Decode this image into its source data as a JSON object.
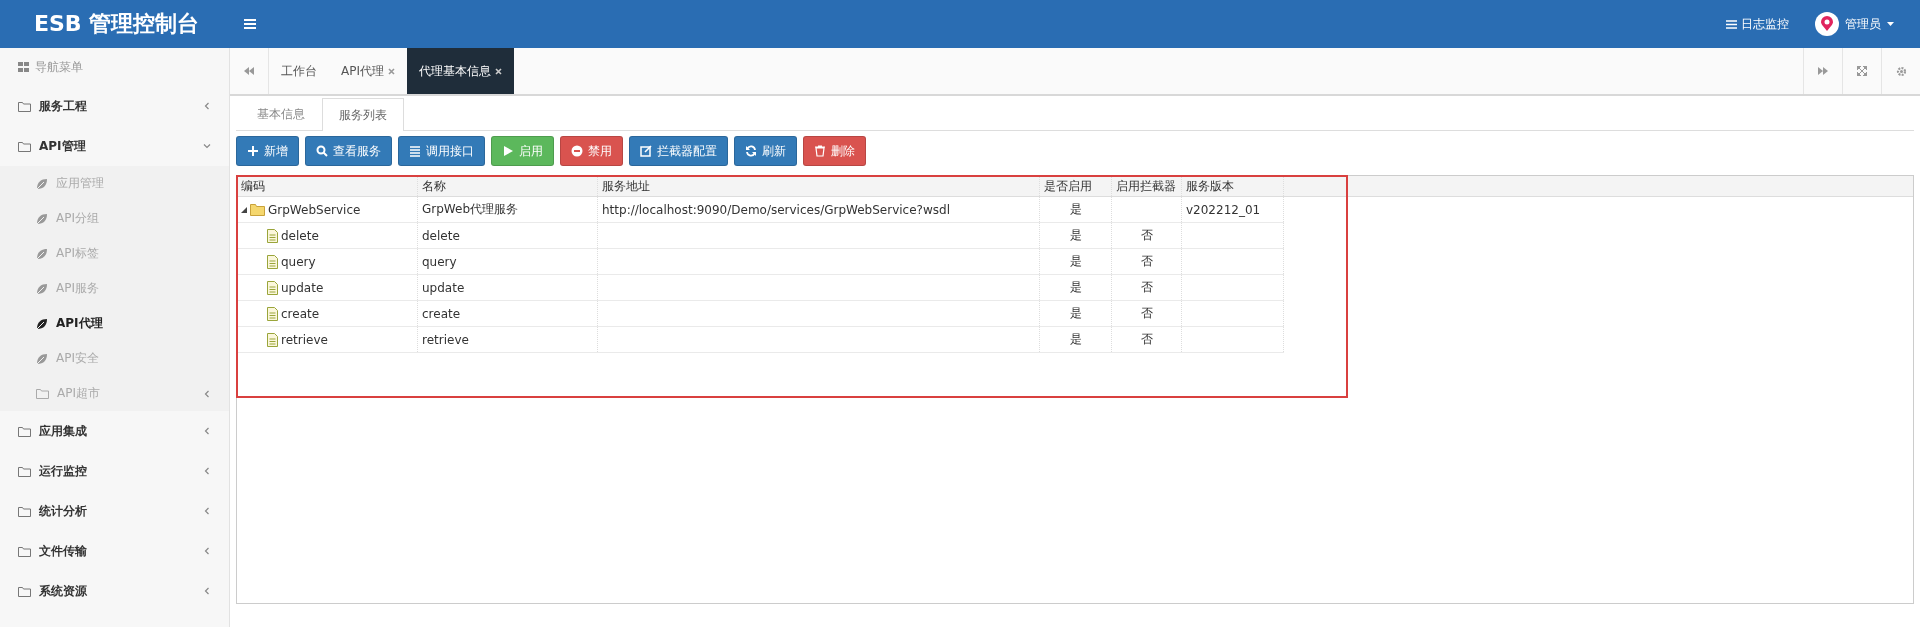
{
  "header": {
    "title": "ESB 管理控制台",
    "log_link": "日志监控",
    "user": "管理员"
  },
  "sidebar": {
    "title": "导航菜单",
    "items": [
      {
        "label": "服务工程",
        "expanded": false
      },
      {
        "label": "API管理",
        "expanded": true,
        "children": [
          {
            "label": "应用管理",
            "kind": "leaf",
            "selected": false
          },
          {
            "label": "API分组",
            "kind": "leaf",
            "selected": false
          },
          {
            "label": "API标签",
            "kind": "leaf",
            "selected": false
          },
          {
            "label": "API服务",
            "kind": "leaf",
            "selected": false
          },
          {
            "label": "API代理",
            "kind": "leaf",
            "selected": true
          },
          {
            "label": "API安全",
            "kind": "leaf",
            "selected": false
          },
          {
            "label": "API超市",
            "kind": "folder",
            "selected": false
          }
        ]
      },
      {
        "label": "应用集成",
        "expanded": false
      },
      {
        "label": "运行监控",
        "expanded": false
      },
      {
        "label": "统计分析",
        "expanded": false
      },
      {
        "label": "文件传输",
        "expanded": false
      },
      {
        "label": "系统资源",
        "expanded": false
      }
    ]
  },
  "tabs": [
    {
      "label": "工作台",
      "closable": false,
      "selected": false
    },
    {
      "label": "API代理",
      "closable": true,
      "selected": false
    },
    {
      "label": "代理基本信息",
      "closable": true,
      "selected": true
    }
  ],
  "subtabs": [
    {
      "label": "基本信息",
      "selected": false
    },
    {
      "label": "服务列表",
      "selected": true
    }
  ],
  "toolbar": [
    {
      "label": "新增",
      "kind": "primary"
    },
    {
      "label": "查看服务",
      "kind": "primary"
    },
    {
      "label": "调用接口",
      "kind": "primary"
    },
    {
      "label": "启用",
      "kind": "success"
    },
    {
      "label": "禁用",
      "kind": "danger"
    },
    {
      "label": "拦截器配置",
      "kind": "primary"
    },
    {
      "label": "刷新",
      "kind": "primary"
    },
    {
      "label": "删除",
      "kind": "danger"
    }
  ],
  "table": {
    "columns": [
      "编码",
      "名称",
      "服务地址",
      "是否启用",
      "启用拦截器",
      "服务版本"
    ],
    "rows": [
      {
        "kind": "folder",
        "expanded": true,
        "cells": [
          "GrpWebService",
          "GrpWeb代理服务",
          "http://localhost:9090/Demo/services/GrpWebService?wsdl",
          "是",
          "",
          "v202212_01"
        ],
        "children": [
          {
            "kind": "file",
            "cells": [
              "delete",
              "delete",
              "",
              "是",
              "否",
              ""
            ]
          },
          {
            "kind": "file",
            "cells": [
              "query",
              "query",
              "",
              "是",
              "否",
              ""
            ]
          },
          {
            "kind": "file",
            "cells": [
              "update",
              "update",
              "",
              "是",
              "否",
              ""
            ]
          },
          {
            "kind": "file",
            "cells": [
              "create",
              "create",
              "",
              "是",
              "否",
              ""
            ]
          },
          {
            "kind": "file",
            "cells": [
              "retrieve",
              "retrieve",
              "",
              "是",
              "否",
              ""
            ]
          }
        ]
      }
    ]
  }
}
